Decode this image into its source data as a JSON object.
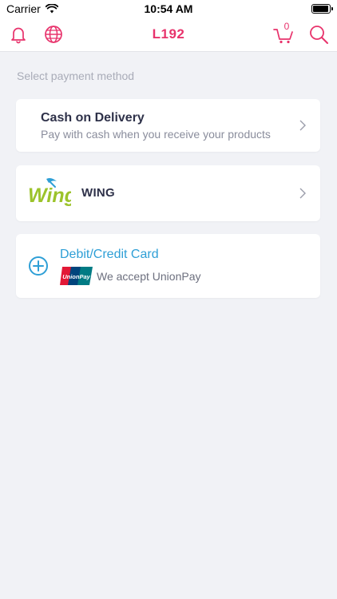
{
  "status_bar": {
    "carrier": "Carrier",
    "time": "10:54 AM"
  },
  "nav": {
    "title": "L192",
    "cart_count": "0",
    "accent_color": "#e8336c"
  },
  "section_label": "Select payment method",
  "payment_methods": {
    "cod": {
      "title": "Cash on Delivery",
      "subtitle": "Pay with cash when you receive your products"
    },
    "wing": {
      "logo_text": "Wing",
      "name": "WING"
    },
    "card": {
      "title": "Debit/Credit Card",
      "logo_text": "UnionPay",
      "subtitle": "We accept UnionPay"
    }
  },
  "icons": [
    "wifi-icon",
    "battery-icon",
    "bell-icon",
    "globe-icon",
    "cart-icon",
    "search-icon",
    "chevron-right-icon",
    "add-circle-icon",
    "wing-logo",
    "unionpay-logo"
  ]
}
